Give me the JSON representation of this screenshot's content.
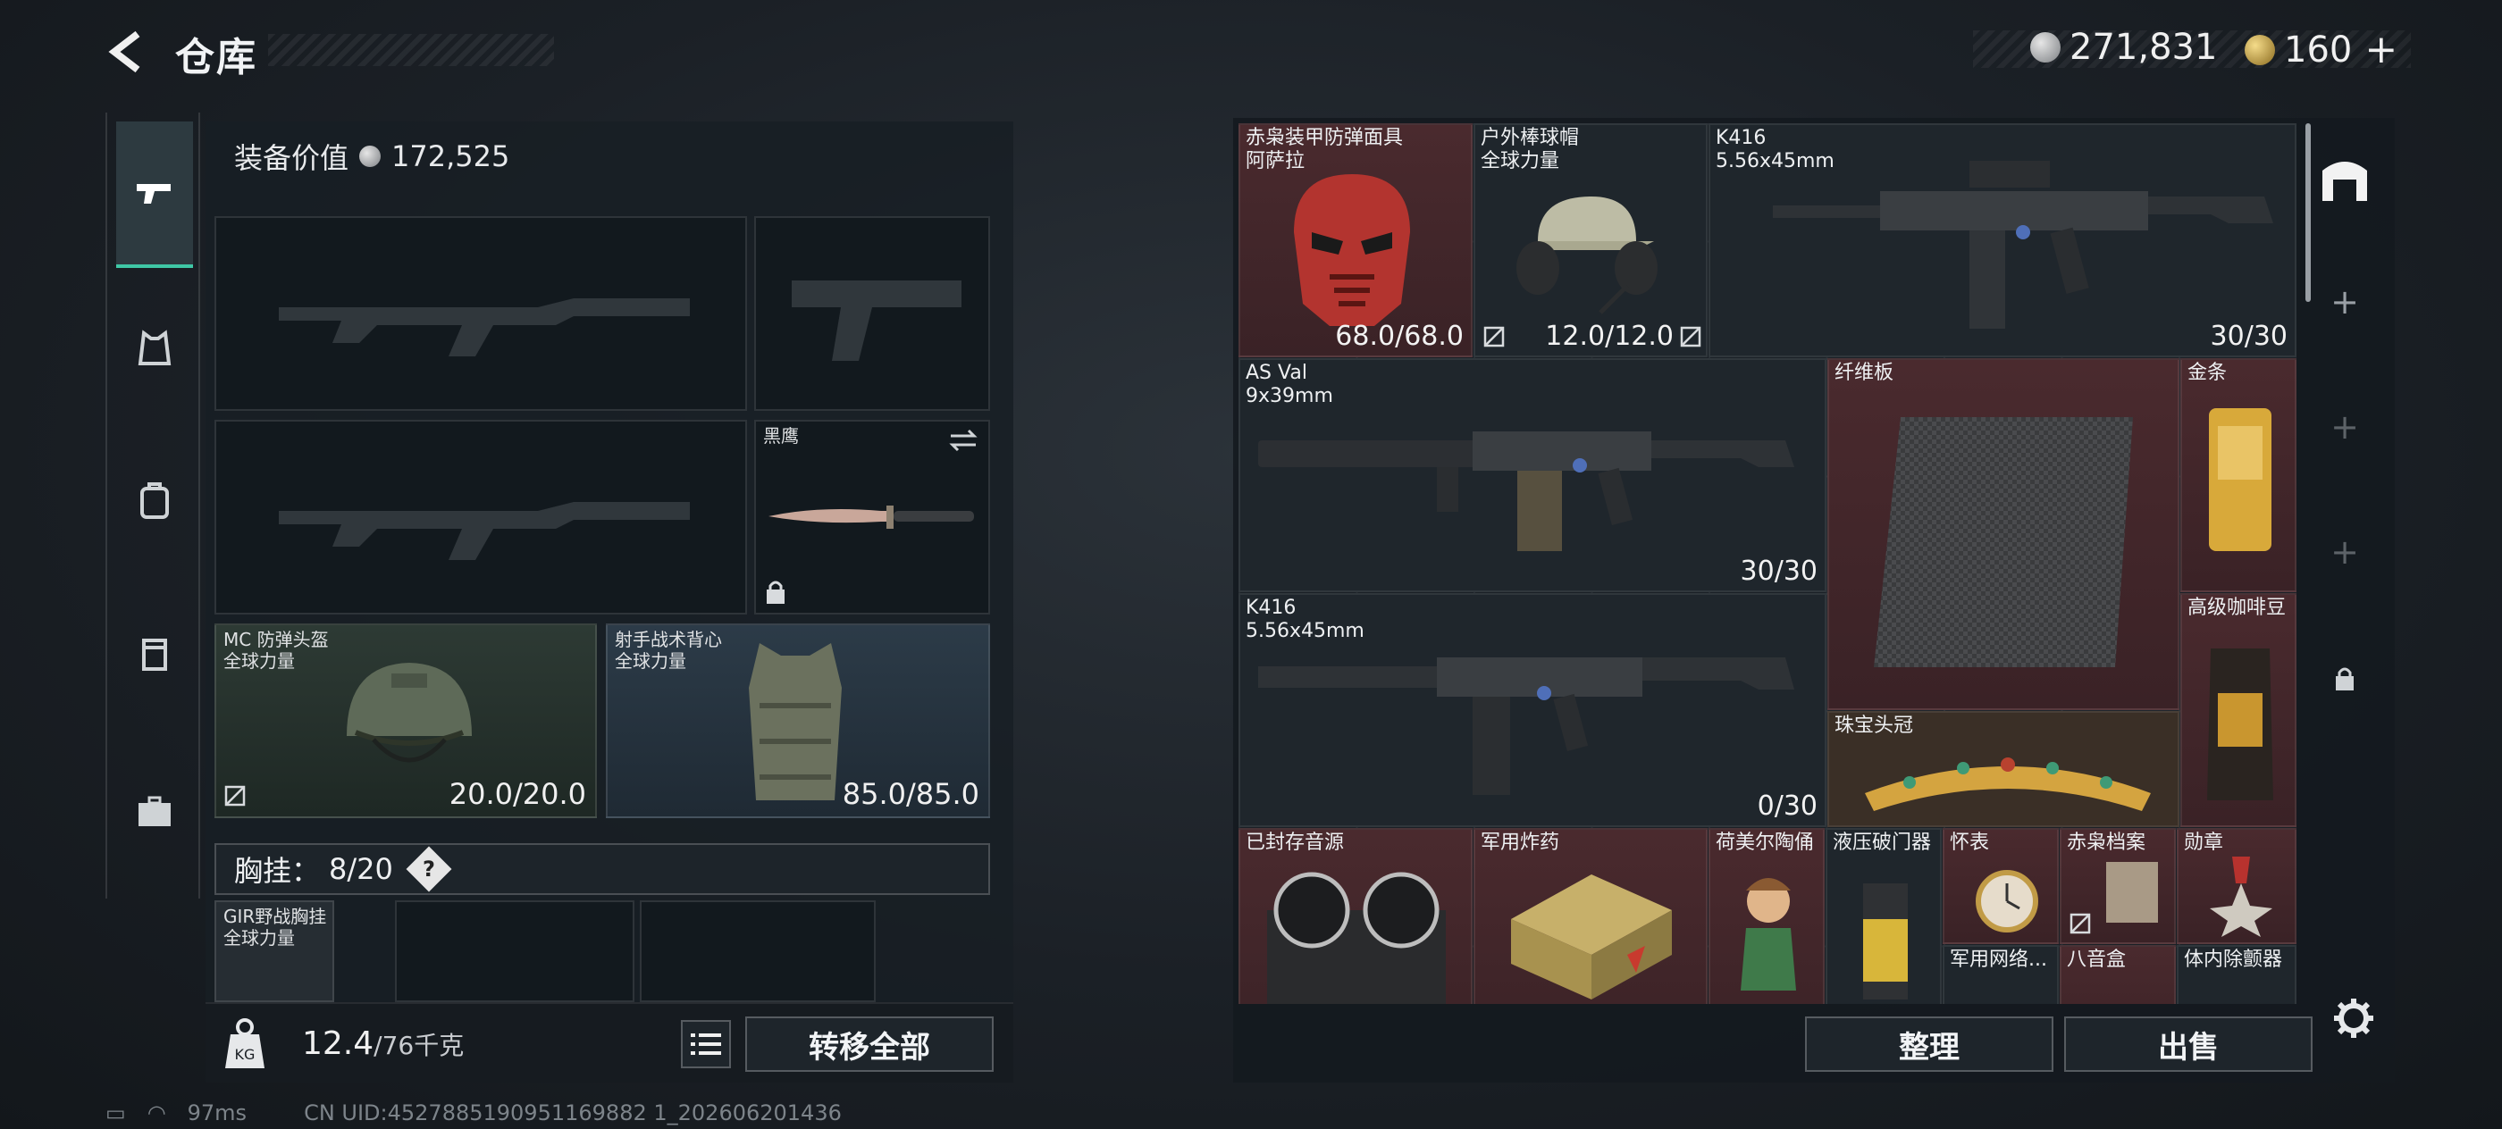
{
  "header": {
    "title": "仓库",
    "currency_silver": "271,831",
    "currency_gold": "160"
  },
  "left_panel": {
    "equip_value_label": "装备价值",
    "equip_value": "172,525",
    "knife_slot": {
      "name": "黑鹰"
    },
    "helmet_slot": {
      "name": "MC 防弹头盔",
      "sub": "全球力量",
      "durability": "20.0/20.0"
    },
    "armor_slot": {
      "name": "射手战术背心",
      "sub": "全球力量",
      "durability": "85.0/85.0"
    },
    "chest_rig": {
      "label": "胸挂：",
      "count": "8/20",
      "help": "?"
    },
    "chest_item": {
      "name": "GIR野战胸挂",
      "sub": "全球力量"
    },
    "weight": {
      "current": "12.4",
      "max": "/76千克"
    },
    "transfer_all": "转移全部"
  },
  "storage": {
    "items": [
      {
        "name": "赤枭装甲防弹面具",
        "sub": "阿萨拉",
        "value": "68.0/68.0"
      },
      {
        "name": "户外棒球帽",
        "sub": "全球力量",
        "value": "12.0/12.0"
      },
      {
        "name": "K416",
        "sub": "5.56x45mm",
        "value": "30/30"
      },
      {
        "name": "AS Val",
        "sub": "9x39mm",
        "value": "30/30"
      },
      {
        "name": "纤维板",
        "sub": "",
        "value": ""
      },
      {
        "name": "金条",
        "sub": "",
        "value": ""
      },
      {
        "name": "K416",
        "sub": "5.56x45mm",
        "value": "0/30"
      },
      {
        "name": "高级咖啡豆",
        "sub": "",
        "value": ""
      },
      {
        "name": "珠宝头冠",
        "sub": "",
        "value": ""
      },
      {
        "name": "已封存音源",
        "sub": "",
        "value": ""
      },
      {
        "name": "军用炸药",
        "sub": "",
        "value": ""
      },
      {
        "name": "荷美尔陶俑",
        "sub": "",
        "value": ""
      },
      {
        "name": "液压破门器",
        "sub": "",
        "value": ""
      },
      {
        "name": "怀表",
        "sub": "",
        "value": ""
      },
      {
        "name": "赤枭档案",
        "sub": "",
        "value": ""
      },
      {
        "name": "勋章",
        "sub": "",
        "value": ""
      },
      {
        "name": "军用网络...",
        "sub": "",
        "value": ""
      },
      {
        "name": "八音盒",
        "sub": "",
        "value": ""
      },
      {
        "name": "体内除颤器",
        "sub": "",
        "value": ""
      }
    ],
    "sort_button": "整理",
    "sell_button": "出售"
  },
  "status": {
    "ping": "97ms",
    "uid": "CN UID:4527885190951169882 1_202606201436"
  },
  "colors": {
    "accent": "#3fc7a6",
    "red_cell": "#4a2a2e"
  }
}
